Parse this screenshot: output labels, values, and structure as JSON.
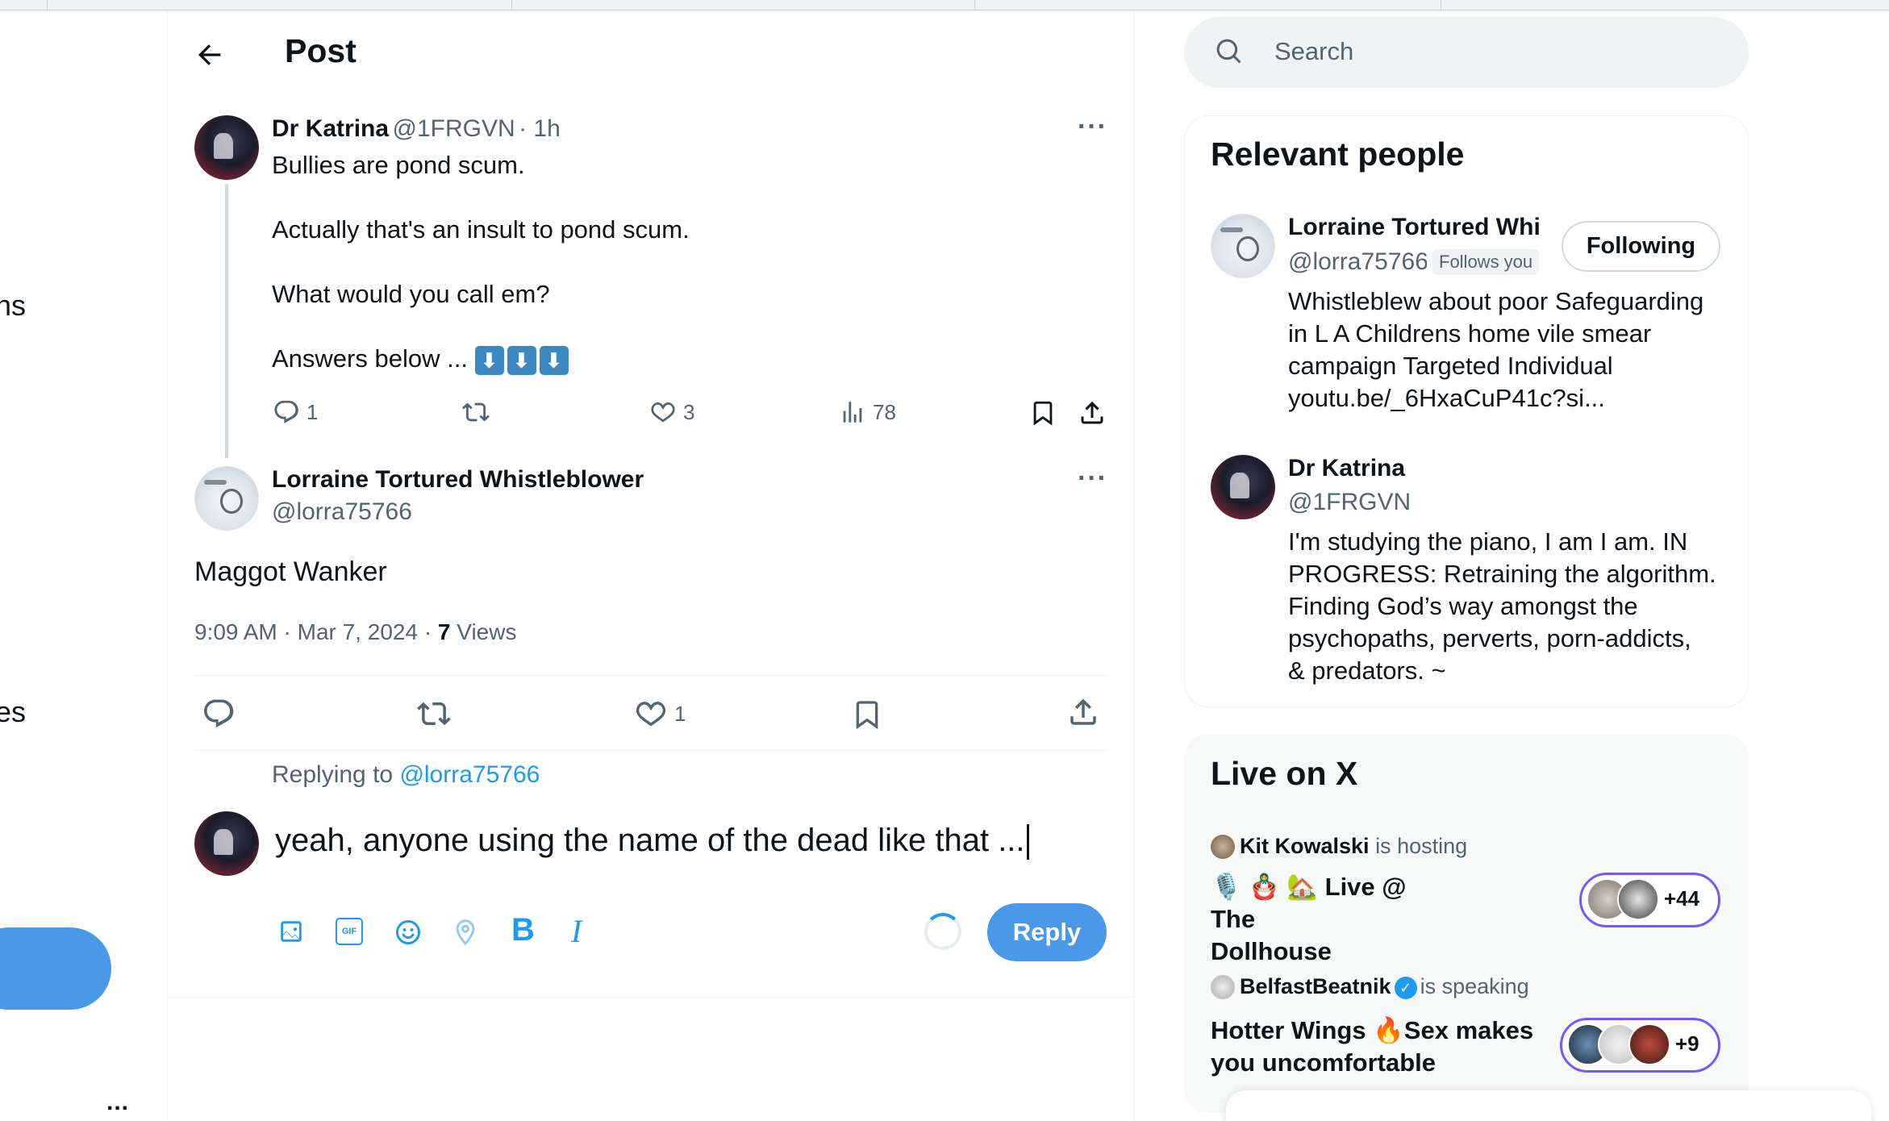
{
  "left_nav": {
    "partial_labels": [
      "ns",
      "es"
    ],
    "more_label": "..."
  },
  "header": {
    "title": "Post"
  },
  "parent_post": {
    "author_name": "Dr Katrina",
    "author_handle": "@1FRGVN",
    "time": "· 1h",
    "lines": [
      "Bullies are pond scum.",
      "Actually that's an insult to pond scum.",
      "What would you call em?",
      "Answers below ..."
    ],
    "emoji_icon": "down-arrow-emoji",
    "metrics": {
      "replies": "1",
      "likes": "3",
      "views": "78"
    }
  },
  "main_post": {
    "author_name": "Lorraine Tortured Whistleblower",
    "author_handle": "@lorra75766",
    "text": "Maggot Wanker",
    "timestamp": "9:09 AM · Mar 7, 2024 ·",
    "views_count": "7",
    "views_label": "Views",
    "metrics": {
      "likes": "1"
    }
  },
  "compose": {
    "replying_to_label": "Replying to",
    "replying_to_handle": "@lorra75766",
    "draft_text": "yeah, anyone using the name of the dead like that ...",
    "reply_button": "Reply",
    "toolbar_icons": [
      "image-icon",
      "gif-icon",
      "emoji-icon",
      "location-icon",
      "bold-icon",
      "italic-icon"
    ],
    "bold_glyph": "B",
    "italic_glyph": "I",
    "gif_glyph": "GIF"
  },
  "search": {
    "placeholder": "Search"
  },
  "relevant_people": {
    "title": "Relevant people",
    "people": [
      {
        "name": "Lorraine Tortured Whi",
        "handle": "@lorra75766",
        "badge": "Follows you",
        "button": "Following",
        "bio_lines": [
          "Whistleblew about poor Safeguarding",
          "in L A Childrens home vile smear",
          "campaign Targeted Individual"
        ],
        "link": "youtu.be/_6HxaCuP41c?si..."
      },
      {
        "name": "Dr Katrina",
        "handle": "@1FRGVN",
        "bio_lines": [
          "I'm studying the piano, I am I am. IN",
          "PROGRESS: Retraining the algorithm.",
          "Finding God’s way amongst the",
          "psychopaths, perverts, porn-addicts,",
          "& predators. ~"
        ]
      }
    ]
  },
  "live": {
    "title": "Live on X",
    "spaces": [
      {
        "host": "Kit Kowalski",
        "status": "is hosting",
        "title_line1": "🎙️ 🪆 🏡 Live @ The",
        "title_line2": "Dollhouse",
        "count": "+44"
      },
      {
        "host": "BelfastBeatnik",
        "status": "is speaking",
        "title_line1": "Hotter Wings 🔥Sex makes",
        "title_line2": "you uncomfortable",
        "count": "+9"
      }
    ]
  },
  "colors": {
    "accent": "#1d9bf0",
    "reply_button": "#4a99e9",
    "space_ring": "#7856ff"
  }
}
